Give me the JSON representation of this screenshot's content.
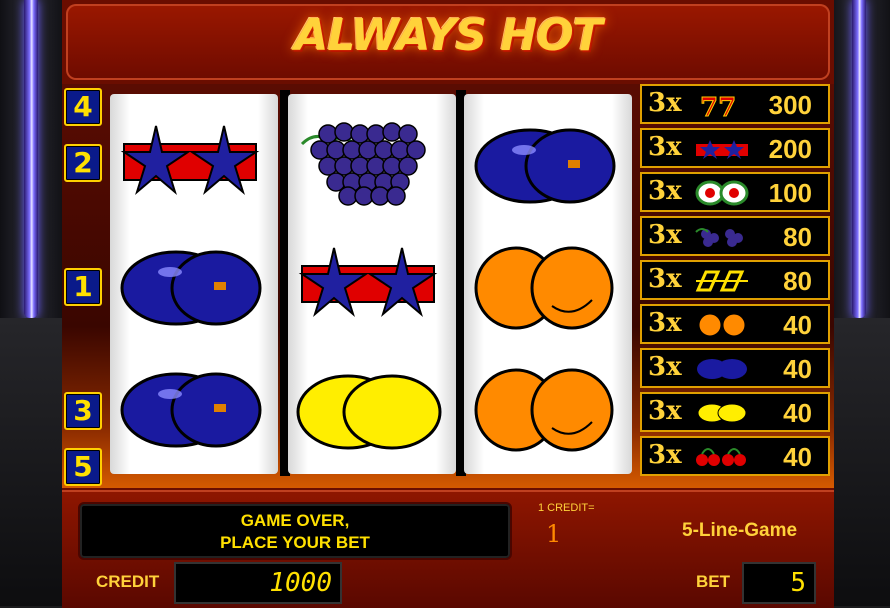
{
  "title": "ALWAYS HOT",
  "line_numbers": [
    "4",
    "2",
    "1",
    "3",
    "5"
  ],
  "reels": [
    [
      "star",
      "plum",
      "plum"
    ],
    [
      "grape",
      "star",
      "lemon"
    ],
    [
      "plum",
      "orange",
      "orange"
    ]
  ],
  "paytable": [
    {
      "mult": "3x",
      "symbol": "seven",
      "value": "300"
    },
    {
      "mult": "3x",
      "symbol": "star",
      "value": "200"
    },
    {
      "mult": "3x",
      "symbol": "melon",
      "value": "100"
    },
    {
      "mult": "3x",
      "symbol": "grape",
      "value": "80"
    },
    {
      "mult": "3x",
      "symbol": "bar",
      "value": "80"
    },
    {
      "mult": "3x",
      "symbol": "orange",
      "value": "40"
    },
    {
      "mult": "3x",
      "symbol": "plum",
      "value": "40"
    },
    {
      "mult": "3x",
      "symbol": "lemon",
      "value": "40"
    },
    {
      "mult": "3x",
      "symbol": "cherry",
      "value": "40"
    }
  ],
  "message": {
    "line1": "GAME OVER,",
    "line2": "PLACE YOUR BET"
  },
  "credit_equals": {
    "label": "1 CREDIT=",
    "value": "1"
  },
  "game_type": "5-Line-Game",
  "credit": {
    "label": "CREDIT",
    "value": "1000"
  },
  "bet": {
    "label": "BET",
    "value": "5"
  },
  "colors": {
    "frame": "#6a0d00",
    "gold": "#ffd23a",
    "plum": "#1a1aa0",
    "orange": "#ff8a00",
    "lemon": "#ffee00"
  }
}
